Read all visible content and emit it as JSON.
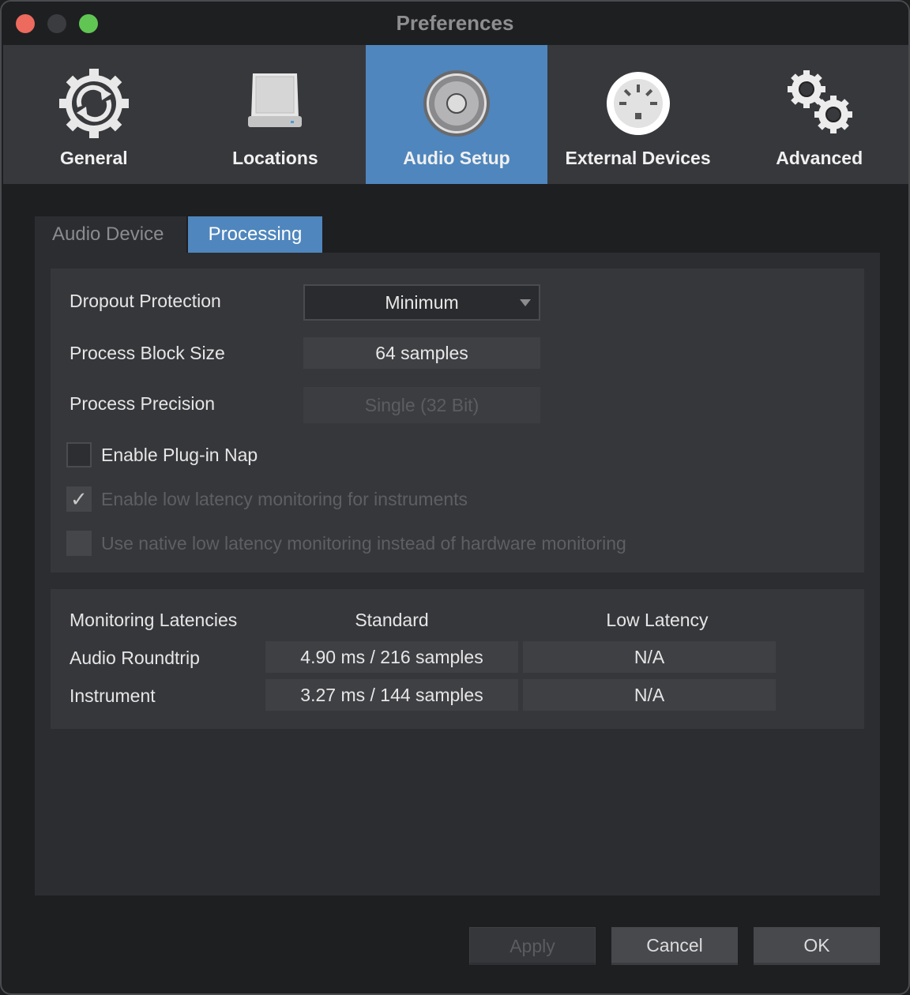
{
  "window": {
    "title": "Preferences"
  },
  "toolbar": {
    "items": [
      {
        "label": "General",
        "icon": "gear-sync-icon",
        "active": false
      },
      {
        "label": "Locations",
        "icon": "hard-drive-icon",
        "active": false
      },
      {
        "label": "Audio Setup",
        "icon": "speaker-icon",
        "active": true
      },
      {
        "label": "External Devices",
        "icon": "midi-port-icon",
        "active": false
      },
      {
        "label": "Advanced",
        "icon": "gears-icon",
        "active": false
      }
    ]
  },
  "subtabs": {
    "items": [
      {
        "label": "Audio Device",
        "active": false
      },
      {
        "label": "Processing",
        "active": true
      }
    ]
  },
  "processing": {
    "dropout_protection": {
      "label": "Dropout Protection",
      "value": "Minimum"
    },
    "block_size": {
      "label": "Process Block Size",
      "value": "64 samples"
    },
    "precision": {
      "label": "Process Precision",
      "value": "Single (32 Bit)",
      "enabled": false
    },
    "checkboxes": [
      {
        "label": "Enable Plug-in Nap",
        "checked": false,
        "enabled": true
      },
      {
        "label": "Enable low latency monitoring for instruments",
        "checked": true,
        "enabled": false
      },
      {
        "label": "Use native low latency monitoring instead of hardware monitoring",
        "checked": false,
        "enabled": false
      }
    ]
  },
  "latencies": {
    "headers": [
      "Monitoring Latencies",
      "Standard",
      "Low Latency"
    ],
    "rows": [
      {
        "label": "Audio Roundtrip",
        "standard": "4.90 ms / 216 samples",
        "low": "N/A"
      },
      {
        "label": "Instrument",
        "standard": "3.27 ms / 144 samples",
        "low": "N/A"
      }
    ]
  },
  "buttons": {
    "apply": "Apply",
    "cancel": "Cancel",
    "ok": "OK"
  },
  "colors": {
    "accent": "#4f86bd",
    "close": "#ec6a5e",
    "maximize": "#61c554"
  }
}
